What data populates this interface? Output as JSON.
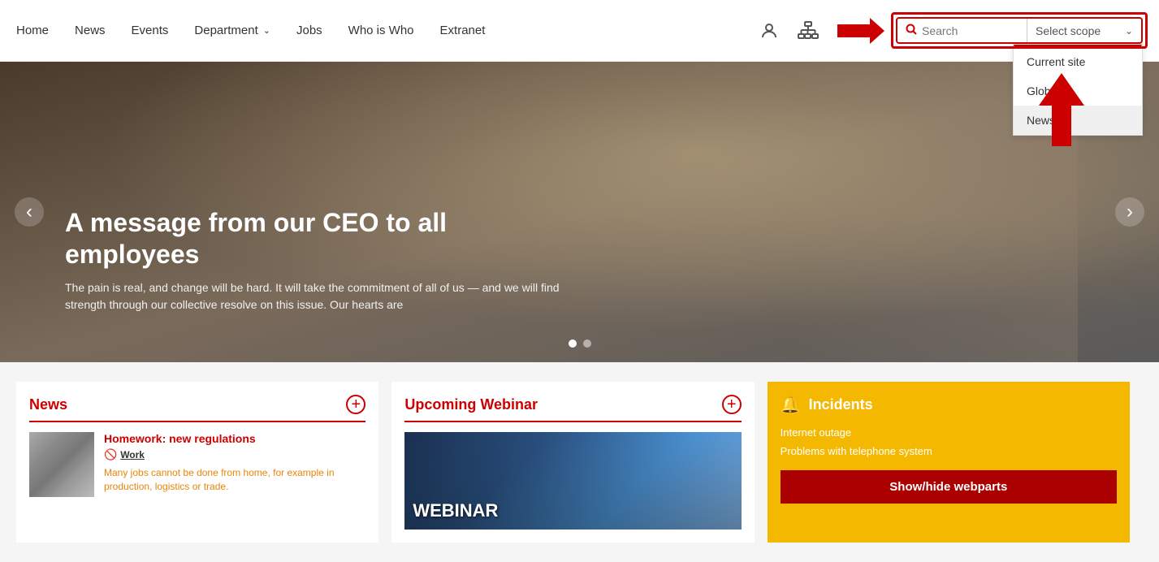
{
  "nav": {
    "links": [
      {
        "label": "Home",
        "id": "home"
      },
      {
        "label": "News",
        "id": "news"
      },
      {
        "label": "Events",
        "id": "events"
      },
      {
        "label": "Department",
        "id": "department",
        "hasDropdown": true
      },
      {
        "label": "Jobs",
        "id": "jobs"
      },
      {
        "label": "Who is Who",
        "id": "who-is-who"
      },
      {
        "label": "Extranet",
        "id": "extranet"
      }
    ]
  },
  "search": {
    "placeholder": "Search",
    "scope_label": "Select scope",
    "dropdown_items": [
      {
        "label": "Current site",
        "id": "current-site"
      },
      {
        "label": "Global",
        "id": "global"
      },
      {
        "label": "News",
        "id": "news"
      }
    ]
  },
  "hero": {
    "title": "A message from our CEO to all employees",
    "description": "The pain is real, and change will be hard. It will take the commitment of all of us — and we will find strength through our collective resolve on this issue. Our hearts are"
  },
  "news_card": {
    "title": "News",
    "add_btn": "+",
    "headline": "Homework: new regulations",
    "tag": "Work",
    "body": "Many jobs cannot be done from home, for example in production, logistics or trade."
  },
  "webinar_card": {
    "title": "Upcoming Webinar",
    "add_btn": "+",
    "overlay_text": "WEBINAR"
  },
  "incidents_card": {
    "title": "Incidents",
    "items": [
      {
        "label": "Internet outage"
      },
      {
        "label": "Problems with telephone system"
      }
    ],
    "show_hide_label": "Show/hide webparts"
  }
}
